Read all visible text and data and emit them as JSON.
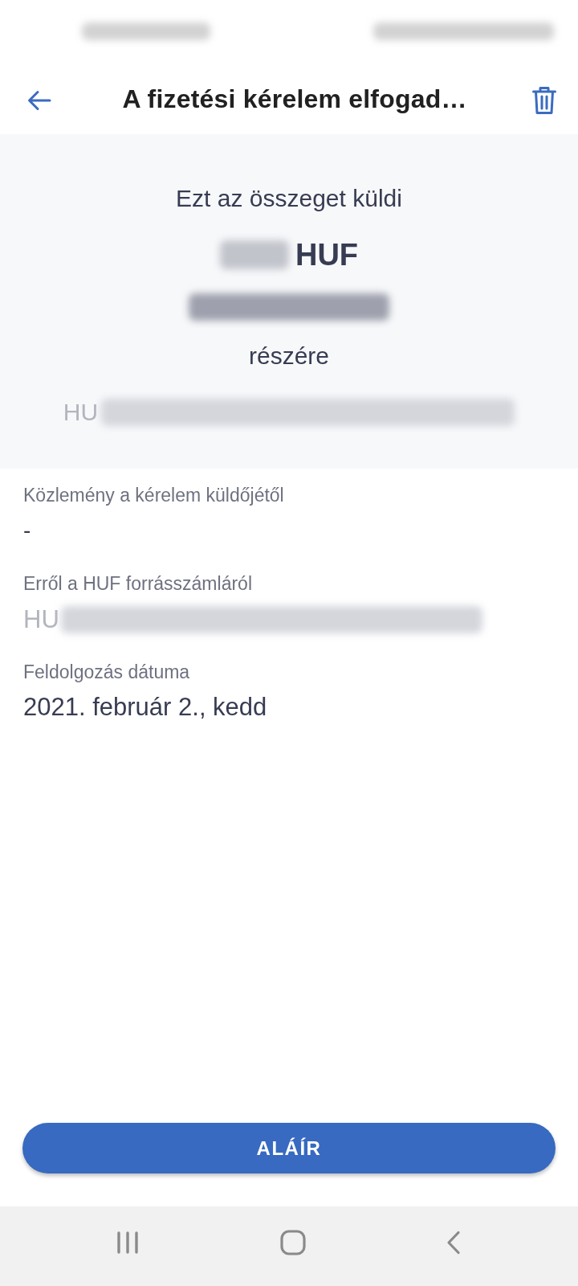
{
  "status_bar": {
    "redacted": true
  },
  "header": {
    "title": "A fizetési kérelem elfogad…"
  },
  "summary": {
    "caption": "Ezt az összeget küldi",
    "amount": {
      "redacted": true,
      "currency": "HUF"
    },
    "recipient_name": {
      "redacted": true
    },
    "recipient_caption": "részére",
    "recipient_account": {
      "prefix": "HU",
      "redacted": true
    }
  },
  "details": [
    {
      "kind": "text",
      "label": "Közlemény a kérelem küldőjétől",
      "value": "-"
    },
    {
      "kind": "account",
      "label": "Erről a HUF forrásszámláról",
      "prefix": "HU",
      "redacted": true
    },
    {
      "kind": "date",
      "label": "Feldolgozás dátuma",
      "value": "2021. február 2., kedd"
    }
  ],
  "primary_button": {
    "label": "ALÁÍR"
  }
}
